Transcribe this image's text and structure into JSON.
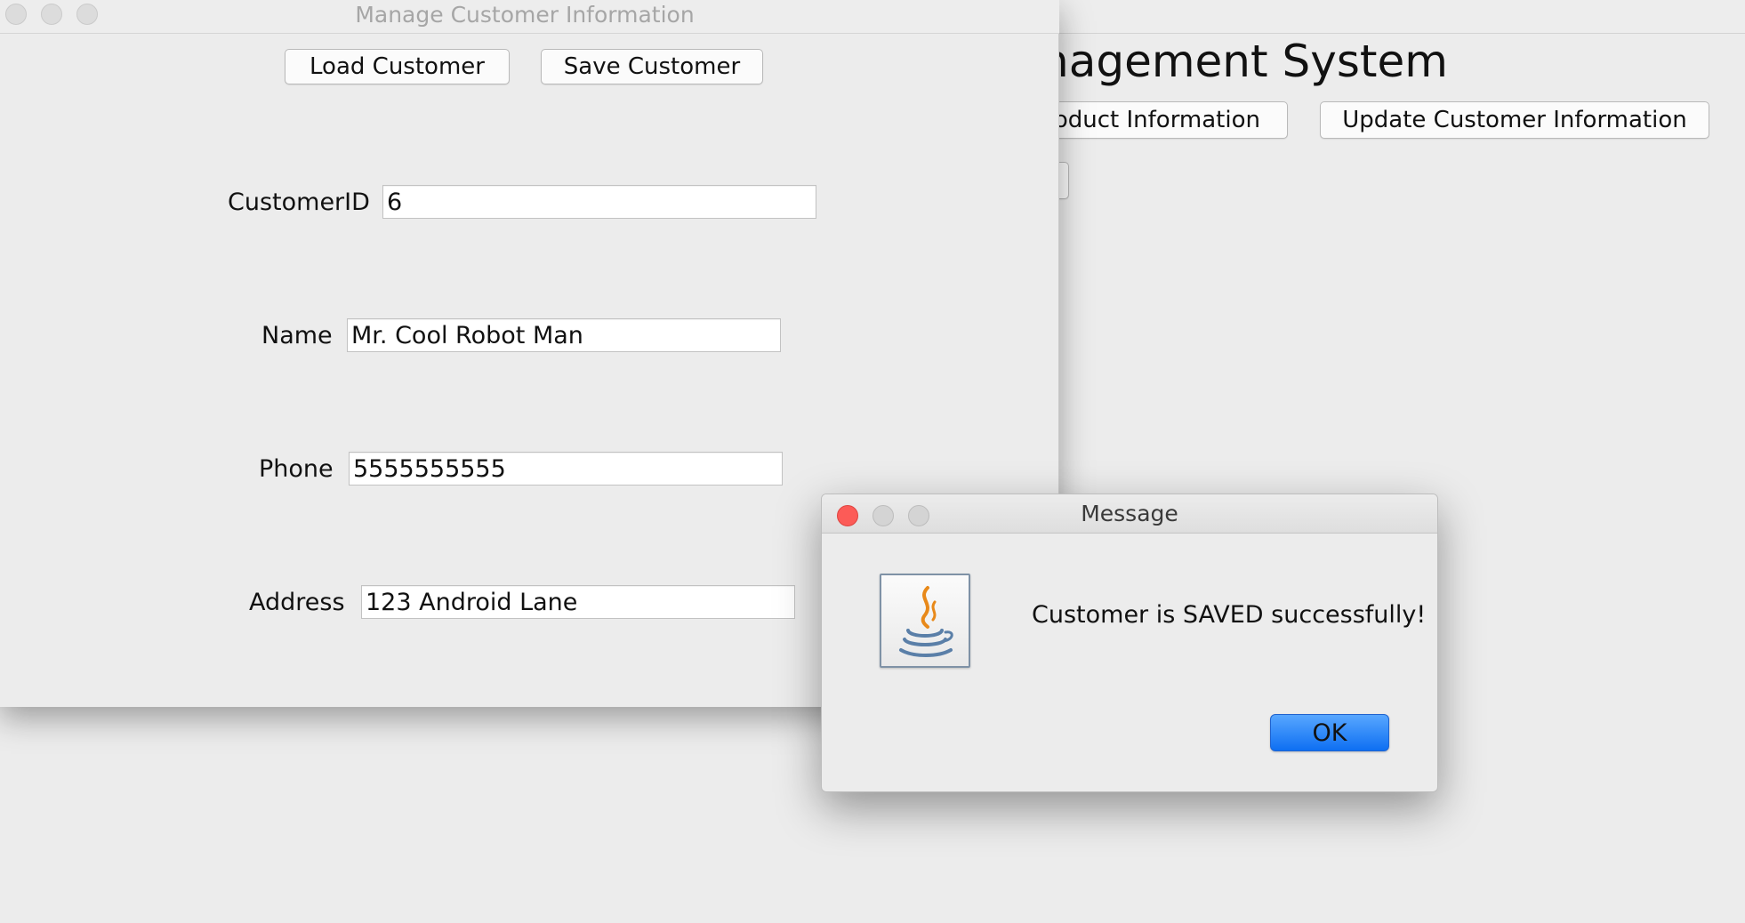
{
  "main_window": {
    "heading": "nagement System",
    "product_button": "oduct Information",
    "update_button": "Update Customer Information"
  },
  "customer_window": {
    "title": "Manage Customer Information",
    "load_button": "Load Customer",
    "save_button": "Save Customer",
    "fields": {
      "customer_id": {
        "label": "CustomerID",
        "value": "6"
      },
      "name": {
        "label": "Name",
        "value": "Mr. Cool Robot Man"
      },
      "phone": {
        "label": "Phone",
        "value": "5555555555"
      },
      "address": {
        "label": "Address",
        "value": "123 Android Lane"
      }
    }
  },
  "dialog": {
    "title": "Message",
    "message": "Customer is SAVED successfully!",
    "ok_button": "OK",
    "icon": "java-icon"
  },
  "colors": {
    "close_button": "#fc5b57",
    "ok_button": "#0e6ff2",
    "window_background": "#ececec"
  }
}
